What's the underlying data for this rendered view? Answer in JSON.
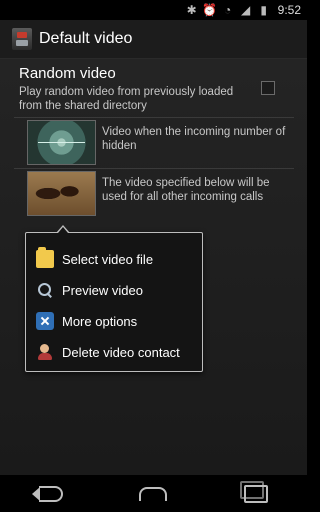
{
  "status_bar": {
    "time": "9:52",
    "icons": [
      "bluetooth-icon",
      "alarm-icon",
      "wifi-icon",
      "signal-icon",
      "battery-icon"
    ]
  },
  "action_bar": {
    "title": "Default video",
    "icon": "app-icon"
  },
  "random_video": {
    "title": "Random video",
    "description": "Play random video from previously loaded from the shared directory",
    "checked": false
  },
  "video_rows": [
    {
      "text": "Video when the incoming number of hidden"
    },
    {
      "text": "The video specified below will be used for all other incoming calls"
    }
  ],
  "popup_menu": {
    "items": [
      {
        "label": "Select video file",
        "icon": "folder-icon"
      },
      {
        "label": "Preview video",
        "icon": "magnifier-icon"
      },
      {
        "label": "More options",
        "icon": "tools-icon"
      },
      {
        "label": "Delete video contact",
        "icon": "contact-delete-icon"
      }
    ]
  },
  "navigation": {
    "buttons": [
      "back-icon",
      "home-icon",
      "recent-apps-icon"
    ]
  },
  "colors": {
    "background": "#000000",
    "action_bar": "#1c1c1c",
    "popup_border": "#bdbdbd",
    "text_primary": "#ffffff",
    "text_secondary": "#c8c8c8"
  }
}
